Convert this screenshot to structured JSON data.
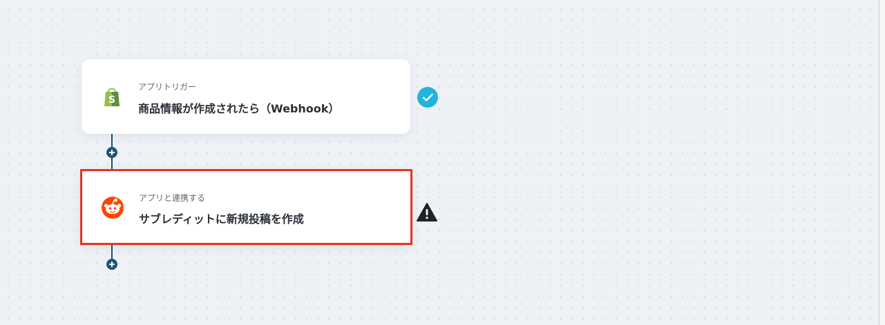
{
  "flow": {
    "trigger": {
      "subtitle": "アプリトリガー",
      "title": "商品情報が作成されたら（Webhook）",
      "icon": "shopify-icon",
      "status": "complete"
    },
    "action": {
      "subtitle": "アプリと連携する",
      "title": "サブレディットに新規投稿を作成",
      "icon": "reddit-icon",
      "status": "warning",
      "selected": true
    }
  },
  "colors": {
    "background": "#eef2f6",
    "connector": "#1d4e6e",
    "check": "#22b4dc",
    "warning": "#1f2328",
    "selection": "#e8321f",
    "shopify": "#95bf47",
    "reddit": "#ff4500"
  }
}
